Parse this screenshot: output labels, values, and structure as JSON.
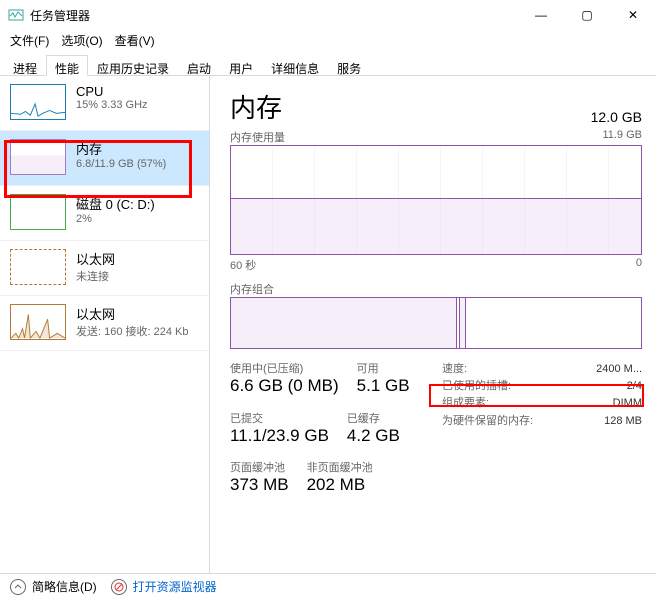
{
  "window": {
    "title": "任务管理器",
    "minimize": "—",
    "maximize": "▢",
    "close": "✕"
  },
  "menu": {
    "file": "文件(F)",
    "options": "选项(O)",
    "view": "查看(V)"
  },
  "tabs": [
    "进程",
    "性能",
    "应用历史记录",
    "启动",
    "用户",
    "详细信息",
    "服务"
  ],
  "sidebar": [
    {
      "name": "CPU",
      "sub": "15% 3.33 GHz"
    },
    {
      "name": "内存",
      "sub": "6.8/11.9 GB (57%)"
    },
    {
      "name": "磁盘 0 (C: D:)",
      "sub": "2%"
    },
    {
      "name": "以太网",
      "sub": "未连接"
    },
    {
      "name": "以太网",
      "sub": "发送: 160 接收: 224 Kb"
    }
  ],
  "main": {
    "title": "内存",
    "total": "12.0 GB",
    "usage_label": "内存使用量",
    "usage_max": "11.9 GB",
    "axis_left": "60 秒",
    "axis_right": "0",
    "comp_label": "内存组合",
    "stats": {
      "in_use_label": "使用中(已压缩)",
      "in_use_value": "6.6 GB (0 MB)",
      "available_label": "可用",
      "available_value": "5.1 GB",
      "committed_label": "已提交",
      "committed_value": "11.1/23.9 GB",
      "cached_label": "已缓存",
      "cached_value": "4.2 GB",
      "paged_label": "页面缓冲池",
      "paged_value": "373 MB",
      "nonpaged_label": "非页面缓冲池",
      "nonpaged_value": "202 MB"
    },
    "right_stats": [
      {
        "label": "速度:",
        "value": "2400 M..."
      },
      {
        "label": "已使用的插槽:",
        "value": "2/4"
      },
      {
        "label": "组成要素:",
        "value": "DIMM"
      },
      {
        "label": "为硬件保留的内存:",
        "value": "128 MB"
      }
    ]
  },
  "footer": {
    "simple": "简略信息(D)",
    "monitor": "打开资源监视器"
  }
}
